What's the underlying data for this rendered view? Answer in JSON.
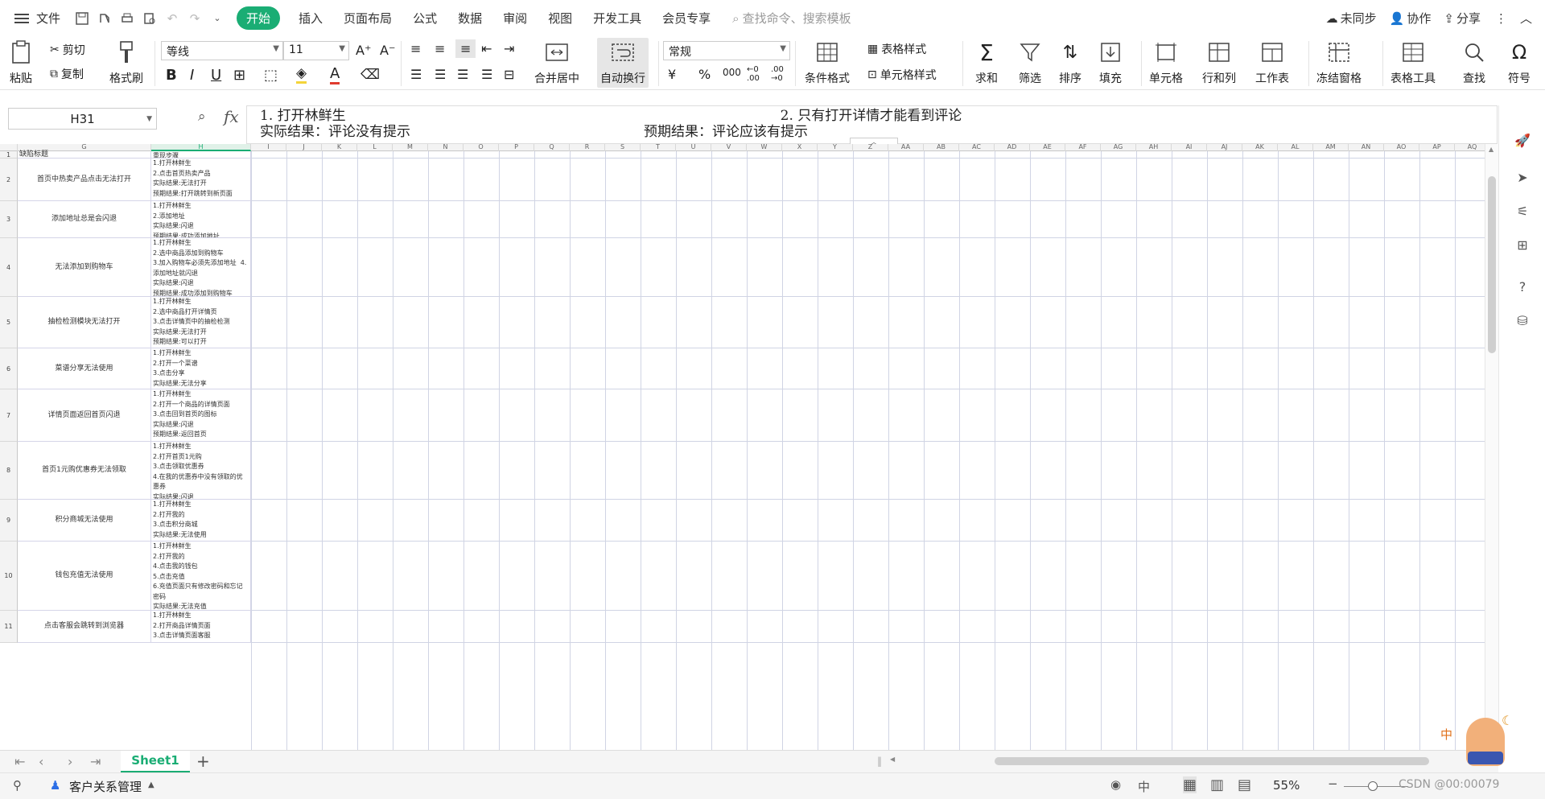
{
  "menubar": {
    "file_label": "文件",
    "tabs": [
      "开始",
      "插入",
      "页面布局",
      "公式",
      "数据",
      "审阅",
      "视图",
      "开发工具",
      "会员专享"
    ],
    "search_placeholder": "查找命令、搜索模板",
    "sync_label": "未同步",
    "collab_label": "协作",
    "share_label": "分享"
  },
  "ribbon": {
    "paste": "粘贴",
    "cut": "剪切",
    "copy": "复制",
    "format_painter": "格式刷",
    "font_name": "等线",
    "font_size": "11",
    "merge_center": "合并居中",
    "wrap_text": "自动换行",
    "number_format": "常规",
    "currency_symbol": "¥",
    "percent_symbol": "%",
    "thousands_symbol": "000",
    "cond_format": "条件格式",
    "table_style": "表格样式",
    "cell_style": "单元格样式",
    "sum": "求和",
    "filter": "筛选",
    "sort": "排序",
    "fill": "填充",
    "cell": "单元格",
    "row_col": "行和列",
    "worksheet": "工作表",
    "freeze": "冻结窗格",
    "table_tools": "表格工具",
    "find": "查找",
    "symbol": "符号"
  },
  "formula_bar": {
    "cell_ref": "H31",
    "fx": "fx",
    "line1_a": "1. 打开林鲜生",
    "line1_b": "2. 只有打开详情才能看到评论",
    "line2_a": "实际结果：评论没有提示",
    "line2_b": "预期结果：评论应该有提示"
  },
  "columns": [
    "G",
    "H",
    "I",
    "J",
    "K",
    "L",
    "M",
    "N",
    "O",
    "P",
    "Q",
    "R",
    "S",
    "T",
    "U",
    "V",
    "W",
    "X",
    "Y",
    "Z",
    "AA",
    "AB",
    "AC",
    "AD",
    "AE",
    "AF",
    "AG",
    "AH",
    "AI",
    "AJ",
    "AK",
    "AL",
    "AM",
    "AN",
    "AO",
    "AP",
    "AQ"
  ],
  "rows": [
    {
      "num": "1",
      "title": "缺陷标题",
      "steps": "重现步骤"
    },
    {
      "num": "2",
      "title": "首页中热卖产品点击无法打开",
      "steps": "1.打开林鲜生\n2.点击首页热卖产品\n实际结果:无法打开\n预期结果:打开跳转到新页面"
    },
    {
      "num": "3",
      "title": "添加地址总是会闪退",
      "steps": "1.打开林鲜生\n2.添加地址\n实际结果:闪退\n预期结果:成功添加地址"
    },
    {
      "num": "4",
      "title": "无法添加到购物车",
      "steps": "1.打开林鲜生\n2.选中商品添加到购物车\n3.加入购物车必须先添加地址  4.添加地址就闪退\n实际结果:闪退\n预期结果:成功添加到购物车"
    },
    {
      "num": "5",
      "title": "抽检检测模块无法打开",
      "steps": "1.打开林鲜生\n2.选中商品打开详情页\n3.点击详情页中的抽检检测\n实际结果:无法打开\n预期结果:可以打开"
    },
    {
      "num": "6",
      "title": "菜谱分享无法使用",
      "steps": "1.打开林鲜生\n2.打开一个菜谱\n3.点击分享\n实际结果:无法分享\n预期结果:可以分享"
    },
    {
      "num": "7",
      "title": "详情页面返回首页闪退",
      "steps": "1.打开林鲜生\n2.打开一个商品的详情页面\n3.点击回到首页的图标\n实际结果:闪退\n预期结果:返回首页"
    },
    {
      "num": "8",
      "title": "首页1元购优惠券无法领取",
      "steps": "1.打开林鲜生\n2.打开首页1元购\n3.点击领取优惠券\n4.在我的优惠券中没有领取的优惠券\n实际结果:闪退\n预期结果:返回首页"
    },
    {
      "num": "9",
      "title": "积分商城无法使用",
      "steps": "1.打开林鲜生\n2.打开我的\n3.点击积分商城\n实际结果:无法使用\n预期结果:可以使用"
    },
    {
      "num": "10",
      "title": "钱包充值无法使用",
      "steps": "1.打开林鲜生\n2.打开我的\n4.点击我的钱包\n5.点击充值\n6.充值页面只有修改密码和忘记密码\n实际结果:无法充值\n预期结果:可以充值"
    },
    {
      "num": "11",
      "title": "点击客服会跳转到浏览器",
      "steps": "1.打开林鲜生\n2.打开商品详情页面\n3.点击详情页面客服\n实际结果:跳转到浏览器"
    }
  ],
  "sheet_tabs": {
    "active": "Sheet1",
    "add": "+"
  },
  "statusbar": {
    "crm": "客户关系管理",
    "ime": "中",
    "zoom": "55%",
    "watermark": "CSDN @00:00079"
  },
  "colors": {
    "accent": "#1aad74",
    "gridline": "#d0d4e4"
  }
}
